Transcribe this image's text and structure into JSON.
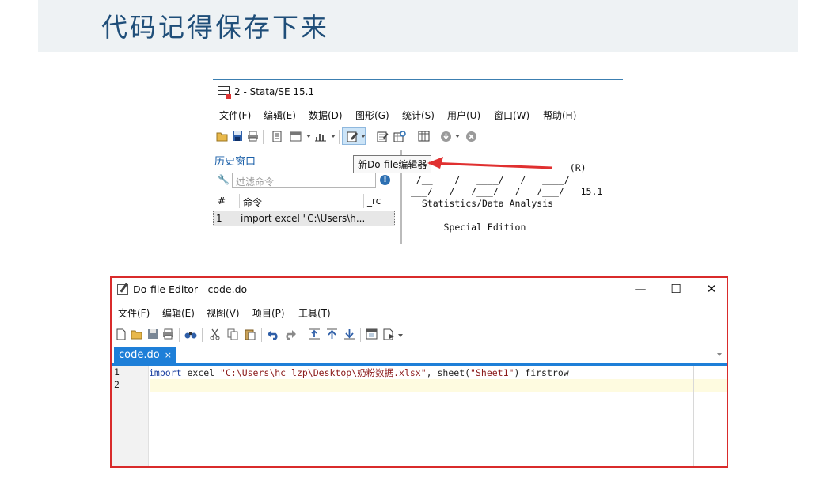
{
  "slide": {
    "title": "代码记得保存下来"
  },
  "stata": {
    "window_title": "2 - Stata/SE 15.1",
    "menu": [
      "文件(F)",
      "编辑(E)",
      "数据(D)",
      "图形(G)",
      "统计(S)",
      "用户(U)",
      "窗口(W)",
      "帮助(H)"
    ],
    "history": {
      "title": "历史窗口",
      "filter_placeholder": "过滤命令",
      "columns": [
        "#",
        "命令",
        "_rc"
      ],
      "rows": [
        {
          "num": "1",
          "command": "import excel \"C:\\Users\\h..."
        }
      ]
    },
    "results_text": " ___  ____  ____  ____  ____ (R)\n /__    /   ____/   /   ____/\n___/   /   /___/   /   /___/   15.1\n  Statistics/Data Analysis\n\n      Special Edition",
    "tooltip": "新Do-file编辑器"
  },
  "editor": {
    "window_title": "Do-file Editor - code.do",
    "menu": [
      "文件(F)",
      "编辑(E)",
      "视图(V)",
      "项目(P)",
      "工具(T)"
    ],
    "tab_label": "code.do",
    "tab_close": "×",
    "lines": [
      {
        "num": "1",
        "keyword": "import",
        "text": " excel ",
        "string": "\"C:\\Users\\hc_lzp\\Desktop\\奶粉数据.xlsx\"",
        "rest": ", sheet(",
        "string2": "\"Sheet1\"",
        "rest2": ") firstrow"
      },
      {
        "num": "2"
      }
    ]
  },
  "colors": {
    "accent_blue": "#1e7fd8",
    "highlight_red": "#d92b2b",
    "title_blue": "#1f4e79"
  },
  "icons": [
    "open-icon",
    "save-icon",
    "print-icon",
    "log-icon",
    "viewer-icon",
    "graph-icon",
    "do-file-editor-icon",
    "data-editor-icon",
    "data-browser-icon",
    "variables-manager-icon",
    "break-icon",
    "clear-icon"
  ]
}
